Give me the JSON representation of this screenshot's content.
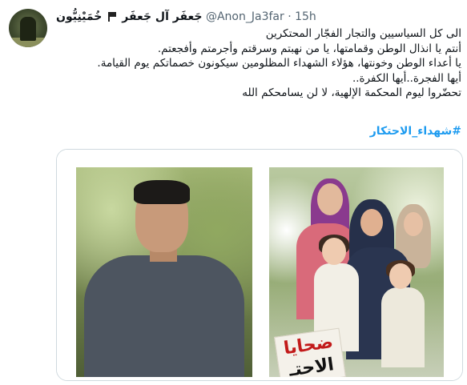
{
  "tweet": {
    "display_name_ar": "جَعفَر آل جَعفَر",
    "display_name_ar2": "خُمَيْنِيُّون",
    "handle": "@Anon_Ja3far",
    "separator": "·",
    "time": "15h",
    "lines": [
      "الى كل السياسيين والتجار الفجّار المحتكرين",
      "أنتم يا انذال الوطن وقمامتها، يا من نهبتم وسرقتم وأجرمتم وأفجعتم.",
      "يا أعداء الوطن وخونتها، هؤلاء الشهداء المظلومين سيكونون خصماتكم يوم القيامة.",
      "أيها الفجرة..أيها الكفرة..",
      "تحضّروا ليوم المحكمة الإلهية، لا لن يسامحكم الله"
    ],
    "hashtag": "#شهداء_الاحتكار"
  },
  "media": {
    "banner_title": "ضحايا",
    "banner_subtitle": "الاحتـ"
  },
  "colors": {
    "link": "#1d9bf0",
    "muted": "#536471",
    "text": "#0f1419",
    "border": "#cfd9de",
    "banner_red": "#c21a1a"
  }
}
